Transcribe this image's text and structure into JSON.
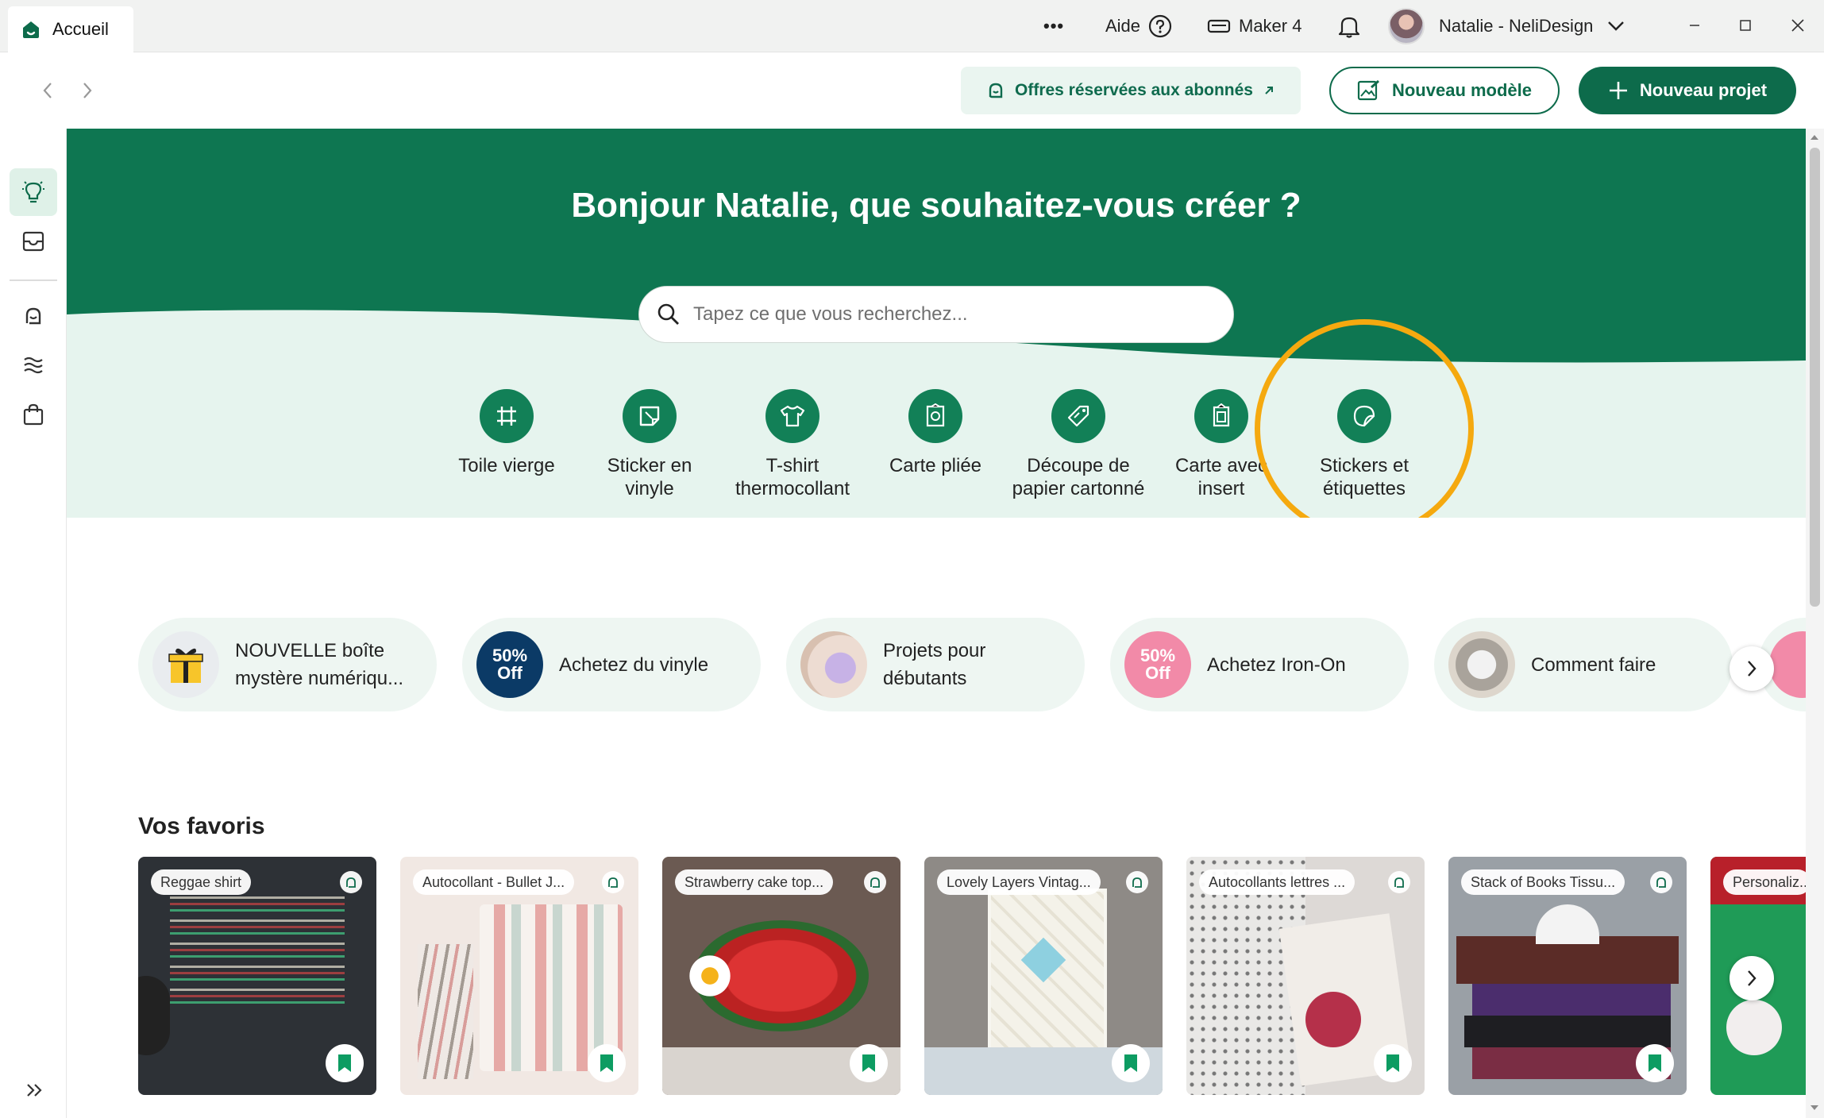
{
  "titlebar": {
    "tab_label": "Accueil",
    "more_label": "•••",
    "help_label": "Aide",
    "machine_label": "Maker 4",
    "user_label": "Natalie - NeliDesign"
  },
  "toolbar": {
    "offers_label": "Offres réservées aux abonnés",
    "new_template_label": "Nouveau modèle",
    "new_project_label": "Nouveau projet"
  },
  "hero": {
    "title": "Bonjour Natalie, que souhaitez-vous créer ?",
    "search_placeholder": "Tapez ce que vous recherchez..."
  },
  "categories": [
    {
      "label": "Toile vierge",
      "icon": "canvas-icon"
    },
    {
      "label": "Sticker en vinyle",
      "icon": "vinyl-sticker-icon"
    },
    {
      "label": "T-shirt thermocollant",
      "icon": "tshirt-icon"
    },
    {
      "label": "Carte pliée",
      "icon": "folded-card-icon"
    },
    {
      "label": "Découpe de papier cartonné",
      "icon": "cardstock-tag-icon"
    },
    {
      "label": "Carte avec insert",
      "icon": "insert-card-icon"
    },
    {
      "label": "Stickers et étiquettes",
      "icon": "stickers-labels-icon"
    }
  ],
  "promos": [
    {
      "label": "NOUVELLE boîte mystère numériqu..."
    },
    {
      "label": "Achetez du vinyle",
      "badge": "50% Off"
    },
    {
      "label": "Projets pour débutants"
    },
    {
      "label": "Achetez Iron-On",
      "badge": "50% Off"
    },
    {
      "label": "Comment faire"
    }
  ],
  "favorites": {
    "title": "Vos favoris",
    "items": [
      {
        "label": "Reggae shirt"
      },
      {
        "label": "Autocollant - Bullet J..."
      },
      {
        "label": "Strawberry cake top..."
      },
      {
        "label": "Lovely Layers Vintag..."
      },
      {
        "label": "Autocollants lettres ..."
      },
      {
        "label": "Stack of Books Tissu..."
      },
      {
        "label": "Personaliz..."
      }
    ]
  },
  "colors": {
    "brand": "#0d6b4b",
    "hero_green": "#0e7651",
    "hero_light": "#e6f4ee",
    "highlight": "#f5a90f",
    "navy_badge": "#0b3a66",
    "pink_badge": "#f28aa8"
  }
}
